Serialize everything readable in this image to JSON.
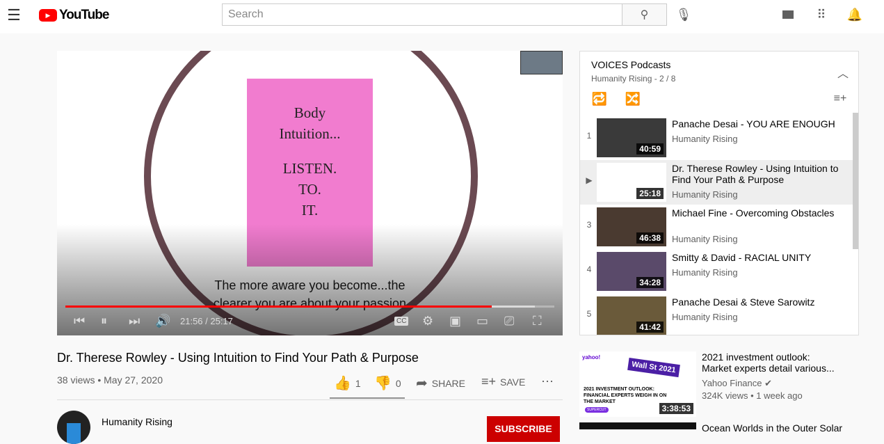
{
  "header": {
    "logo": "YouTube",
    "search_placeholder": "Search"
  },
  "player": {
    "card_lines": [
      "Body",
      "Intuition...",
      "",
      "LISTEN.",
      "TO.",
      "IT."
    ],
    "subtitle_1": "The more aware you become...the",
    "subtitle_2": "clearer you are about your passion",
    "time": "21:56 / 25:17",
    "progress": 0.872,
    "buffered": 0.96
  },
  "video": {
    "title": "Dr. Therese Rowley - Using Intuition to Find Your Path & Purpose",
    "views_date": "38 views • May 27, 2020",
    "likes": "1",
    "dislikes": "0",
    "share": "SHARE",
    "save": "SAVE"
  },
  "channel": {
    "name": "Humanity Rising",
    "subscribe": "SUBSCRIBE"
  },
  "playlist": {
    "title": "VOICES Podcasts",
    "subtitle": "Humanity Rising - 2 / 8",
    "items": [
      {
        "idx": "1",
        "title": "Panache Desai - YOU ARE ENOUGH",
        "channel": "Humanity Rising",
        "duration": "40:59"
      },
      {
        "idx": "▶",
        "title": "Dr. Therese Rowley - Using Intuition to Find Your Path & Purpose",
        "channel": "Humanity Rising",
        "duration": "25:18"
      },
      {
        "idx": "3",
        "title": "Michael Fine - Overcoming Obstacles",
        "channel": "Humanity Rising",
        "duration": "46:38"
      },
      {
        "idx": "4",
        "title": "Smitty & David - RACIAL UNITY",
        "channel": "Humanity Rising",
        "duration": "34:28"
      },
      {
        "idx": "5",
        "title": "Panache Desai & Steve Sarowitz",
        "channel": "Humanity Rising",
        "duration": "41:42"
      }
    ]
  },
  "related": [
    {
      "title": "2021 investment outlook: Market experts detail various...",
      "channel": "Yahoo Finance",
      "meta": "324K views • 1 week ago",
      "duration": "3:38:53",
      "thumb_brand": "yahoo!",
      "thumb_sign": "Wall St 2021",
      "thumb_text": "2021 INVESTMENT OUTLOOK: FINANCIAL EXPERTS WEIGH IN ON THE MARKET",
      "thumb_badge": "SUPERCUT"
    },
    {
      "title": "Ocean Worlds in the Outer Solar"
    }
  ]
}
